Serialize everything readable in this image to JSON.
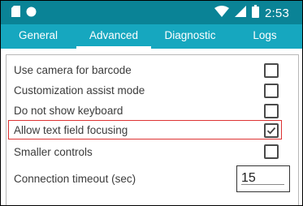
{
  "status_bar": {
    "time": "2:53",
    "icons": [
      "sd-card-icon",
      "circle-icon",
      "wifi-icon",
      "cellular-icon",
      "battery-icon"
    ],
    "background": "#0a8396"
  },
  "tabs": [
    {
      "label": "General",
      "active": false
    },
    {
      "label": "Advanced",
      "active": true
    },
    {
      "label": "Diagnostic",
      "active": false
    },
    {
      "label": "Logs",
      "active": false
    }
  ],
  "tab_bar_color": "#16a7bf",
  "settings": [
    {
      "label": "Use camera for barcode",
      "checked": false
    },
    {
      "label": "Customization assist mode",
      "checked": false
    },
    {
      "label": "Do not show keyboard",
      "checked": false
    },
    {
      "label": "Allow text field focusing",
      "checked": true,
      "highlighted": true
    },
    {
      "label": "Smaller controls",
      "checked": false
    }
  ],
  "timeout": {
    "label": "Connection timeout (sec)",
    "value": "15"
  },
  "highlight_color": "#dd3333"
}
